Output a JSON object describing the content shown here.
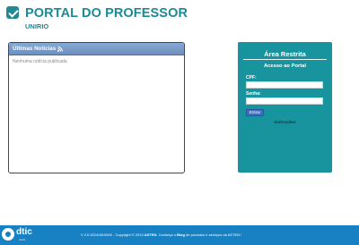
{
  "header": {
    "title": "PORTAL DO PROFESSOR",
    "subtitle": "UNIRIO"
  },
  "news": {
    "title": "Últimas Notícias",
    "empty_message": "Nenhuma notícia publicada"
  },
  "login": {
    "title": "Área Restrita",
    "subtitle": "Acesso ao Portal",
    "cpf_label": "CPF:",
    "cpf_value": "",
    "password_label": "Senha:",
    "password_value": "",
    "submit_label": "Entrar",
    "instructions_link": "Instruções"
  },
  "footer": {
    "brand": "dtic",
    "brand_sub": "unirio",
    "version": "V 2.0.20140610002 - Copyright © 2013 ",
    "company": "ASTEN",
    "text_mid": ". Conheça o ",
    "blog": "Blog",
    "text_end": " de produtos e serviços da ASTEN !"
  },
  "colors": {
    "brand_teal": "#1a8a96",
    "restricted_bg": "#17949e",
    "footer_bg": "#1781c4",
    "news_header": "#6c8fbd",
    "button_blue": "#3d6fc4"
  }
}
